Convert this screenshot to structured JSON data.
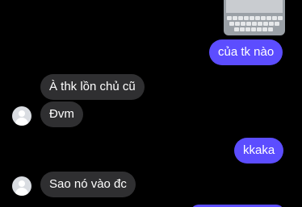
{
  "messages": {
    "sent_1": "của tk nào",
    "recv_1": "À thk lồn chủ cũ",
    "recv_2": "Đvm",
    "sent_2": "kkaka",
    "recv_3": "Sao nó vào đc"
  },
  "colors": {
    "background": "#000000",
    "sent_bubble": "#5c4dff",
    "received_bubble": "#2f2f31",
    "text": "#ffffff"
  },
  "icons": {
    "avatar": "default-avatar-icon",
    "attachment": "screenshot-thumbnail"
  }
}
